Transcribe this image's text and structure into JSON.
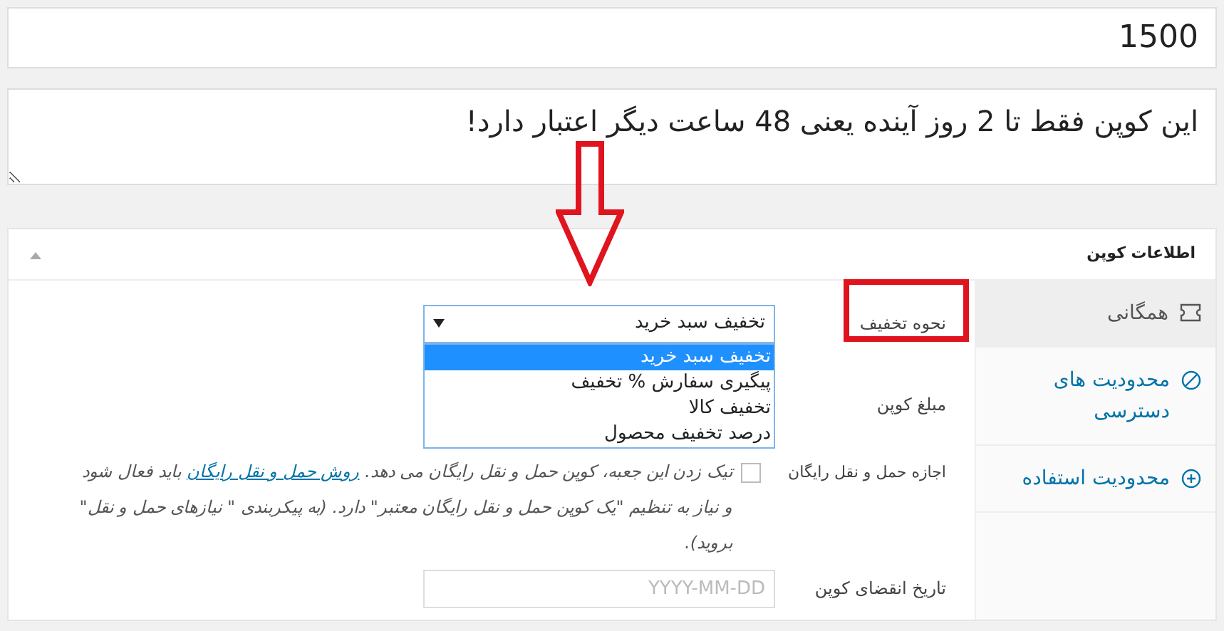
{
  "amount_field": {
    "value": "1500"
  },
  "description_field": {
    "value": "این کوپن فقط تا 2 روز آینده یعنی 48 ساعت دیگر اعتبار دارد!"
  },
  "panel": {
    "title": "اطلاعات کوپن",
    "expanded": true
  },
  "tabs": [
    {
      "label": "همگانی",
      "kind": "ticket",
      "selected": true
    },
    {
      "label": "محدودیت های دسترسی",
      "kind": "blocked",
      "selected": false
    },
    {
      "label": "محدودیت استفاده",
      "kind": "plus-circle",
      "selected": false
    }
  ],
  "discount_type": {
    "label": "نحوه تخفیف",
    "value": "تخفیف سبد خرید",
    "expanded": true,
    "options": [
      {
        "label": "تخفیف سبد خرید",
        "selected": true
      },
      {
        "label": "پیگیری سفارش % تخفیف",
        "selected": false
      },
      {
        "label": "تخفیف کالا",
        "selected": false
      },
      {
        "label": "درصد تخفیف محصول",
        "selected": false
      }
    ]
  },
  "amount": {
    "label": "مبلغ کوپن"
  },
  "free_shipping": {
    "label": "اجازه حمل و نقل رایگان",
    "checked": false,
    "text_before": "تیک زدن این جعبه، کوپن حمل و نقل رایگان می دهد.",
    "link": "روش حمل و نقل رایگان",
    "text_after": "باید فعال شود و نیاز به تنظیم \"یک کوپن حمل و نقل رایگان معتبر\" دارد. (به پیکربندی \" نیازهای حمل و نقل\" بروید)."
  },
  "expiry": {
    "label": "تاریخ انقضای کوپن",
    "placeholder": "YYYY-MM-DD"
  }
}
